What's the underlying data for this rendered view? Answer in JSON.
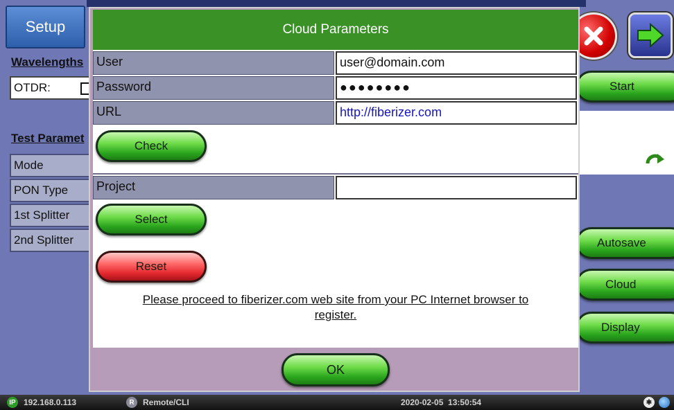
{
  "background": {
    "setup_tab": "Setup",
    "wavelengths_label": "Wavelengths",
    "otdr_label": "OTDR:",
    "test_params_label": "Test Paramet",
    "left_items": [
      "Mode",
      "PON Type",
      "1st Splitter",
      "2nd Splitter"
    ],
    "right_buttons": {
      "start": "Start",
      "autosave": "Autosave",
      "cloud": "Cloud",
      "display": "Display"
    }
  },
  "dialog": {
    "title": "Cloud Parameters",
    "fields": {
      "user_label": "User",
      "user_value": "user@domain.com",
      "password_label": "Password",
      "password_value": "●●●●●●●●",
      "url_label": "URL",
      "url_value": "http://fiberizer.com",
      "project_label": "Project",
      "project_value": ""
    },
    "buttons": {
      "check": "Check",
      "select": "Select",
      "reset": "Reset",
      "ok": "OK"
    },
    "notice_line1": "Please proceed to fiberizer.com web site from your PC Internet browser to",
    "notice_line2": "register."
  },
  "statusbar": {
    "ip_badge": "IP",
    "ip_address": "192.168.0.113",
    "remote_badge": "R",
    "remote_label": "Remote/CLI",
    "datetime": "2020-02-05  13:50:54"
  },
  "colors": {
    "dialog_title_bg": "#3a9227",
    "label_bg": "#9093ad",
    "green_button": "#2aa51d",
    "red_button": "#e2262e",
    "link": "#1616c0"
  },
  "icons": [
    "close-icon",
    "next-arrow-icon",
    "refresh-arrow-icon",
    "bluetooth-icon",
    "globe-icon"
  ]
}
